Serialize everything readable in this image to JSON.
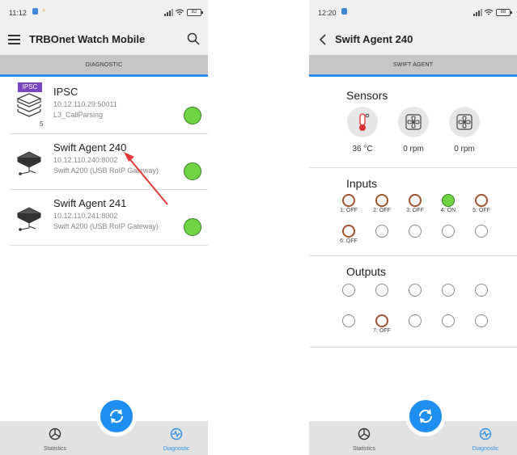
{
  "screen1": {
    "status": {
      "time": "11:12",
      "battery": "82"
    },
    "title": "TRBOnet Watch Mobile",
    "section": "DIAGNOSTIC",
    "items": [
      {
        "name": "IPSC",
        "address": "10.12.110.29:50011",
        "detail": "L3_CallParsing",
        "badge": "IPSC",
        "count": "5",
        "status": "green"
      },
      {
        "name": "Swift Agent 240",
        "address": "10.12.110.240:8002",
        "detail": "Swift A200 (USB RoIP Gateway)",
        "status": "green"
      },
      {
        "name": "Swift Agent 241",
        "address": "10.12.110.241:8002",
        "detail": "Swift A200 (USB RoIP Gateway)",
        "status": "green"
      }
    ],
    "nav": {
      "statistics": "Statistics",
      "diagnostic": "Diagnostic"
    }
  },
  "screen2": {
    "status": {
      "time": "12:20",
      "battery": "88"
    },
    "title": "Swift Agent 240",
    "section": "SWIFT AGENT",
    "sensors": {
      "title": "Sensors",
      "items": [
        {
          "icon": "thermometer-icon",
          "value": "36 °C"
        },
        {
          "icon": "fan-icon",
          "value": "0 rpm"
        },
        {
          "icon": "fan-icon",
          "value": "0 rpm"
        }
      ]
    },
    "inputs": {
      "title": "Inputs",
      "items": [
        {
          "label": "1: OFF",
          "state": "off"
        },
        {
          "label": "2: OFF",
          "state": "off"
        },
        {
          "label": "3: OFF",
          "state": "off"
        },
        {
          "label": "4: ON",
          "state": "on"
        },
        {
          "label": "5: OFF",
          "state": "off"
        },
        {
          "label": "6: OFF",
          "state": "off"
        },
        {
          "label": "",
          "state": "none"
        },
        {
          "label": "",
          "state": "none"
        },
        {
          "label": "",
          "state": "none"
        },
        {
          "label": "",
          "state": "none"
        }
      ]
    },
    "outputs": {
      "title": "Outputs",
      "items": [
        {
          "label": "",
          "state": "none"
        },
        {
          "label": "",
          "state": "none"
        },
        {
          "label": "",
          "state": "none"
        },
        {
          "label": "",
          "state": "none"
        },
        {
          "label": "",
          "state": "none"
        },
        {
          "label": "",
          "state": "none"
        },
        {
          "label": "7: OFF",
          "state": "off"
        },
        {
          "label": "",
          "state": "none"
        },
        {
          "label": "",
          "state": "none"
        },
        {
          "label": "",
          "state": "none"
        }
      ]
    },
    "nav": {
      "statistics": "Statistics",
      "diagnostic": "Diagnostic"
    }
  },
  "colors": {
    "accent": "#1f8ef1",
    "online": "#6fd441",
    "off_ring": "#a0522d",
    "ipsc_badge": "#7a43bf"
  }
}
